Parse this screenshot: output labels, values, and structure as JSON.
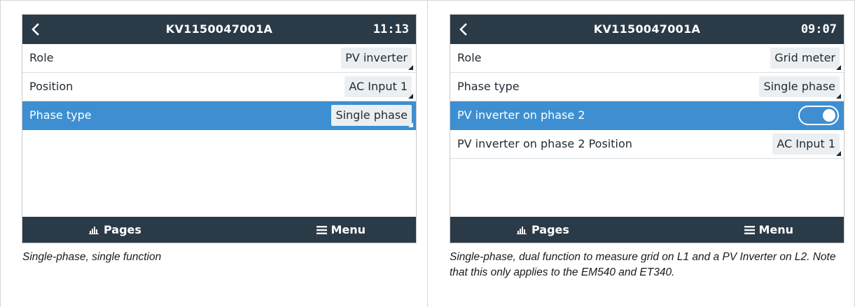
{
  "left": {
    "header": {
      "title": "KV1150047001A",
      "time": "11:13"
    },
    "rows": [
      {
        "label": "Role",
        "value": "PV inverter"
      },
      {
        "label": "Position",
        "value": "AC Input 1"
      },
      {
        "label": "Phase type",
        "value": "Single phase"
      }
    ],
    "footer": {
      "pages": "Pages",
      "menu": "Menu"
    },
    "caption": "Single-phase, single function"
  },
  "right": {
    "header": {
      "title": "KV1150047001A",
      "time": "09:07"
    },
    "rows": [
      {
        "label": "Role",
        "value": "Grid meter"
      },
      {
        "label": "Phase type",
        "value": "Single phase"
      },
      {
        "label": "PV inverter on phase 2",
        "toggle": "on"
      },
      {
        "label": "PV inverter on phase 2 Position",
        "value": "AC Input 1"
      }
    ],
    "footer": {
      "pages": "Pages",
      "menu": "Menu"
    },
    "caption": "Single-phase, dual function to measure grid on L1 and a PV Inverter on L2. Note that this only applies to the EM540 and ET340."
  },
  "colors": {
    "bar": "#2b3a47",
    "selected": "#3d8fd1",
    "chip": "#eceff1"
  },
  "icons": [
    "back-arrow-icon",
    "bar-chart-icon",
    "hamburger-menu-icon"
  ]
}
